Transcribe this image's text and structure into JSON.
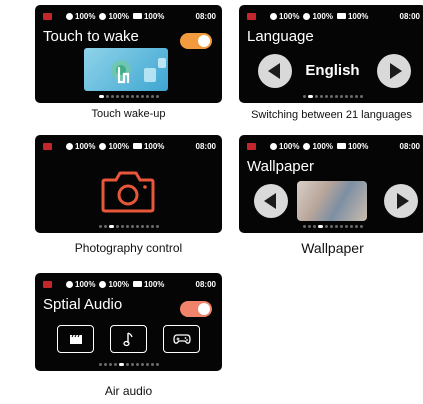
{
  "status_bar": {
    "battery_left": "100%",
    "battery_right": "100%",
    "battery_case": "100%",
    "time": "08:00"
  },
  "cards": {
    "touch": {
      "title": "Touch to wake",
      "caption": "Touch wake-up",
      "toggle_on": true
    },
    "language": {
      "title": "Language",
      "value": "English",
      "caption": "Switching between 21 languages"
    },
    "photo": {
      "caption": "Photography control"
    },
    "wallpaper": {
      "title": "Wallpaper",
      "caption": "Wallpaper"
    },
    "audio": {
      "title": "Sptial Audio",
      "caption": "Air audio",
      "toggle_on": true
    }
  },
  "colors": {
    "screen_bg": "#050505",
    "accent_orange": "#f19a3e",
    "accent_pink": "#f0836a",
    "camera_icon": "#e8573a",
    "brand_red": "#c3272c"
  },
  "icons": [
    "camera-icon",
    "chevron-left-icon",
    "chevron-right-icon",
    "clapperboard-icon",
    "music-note-icon",
    "gamepad-icon",
    "tap-hand-icon"
  ]
}
